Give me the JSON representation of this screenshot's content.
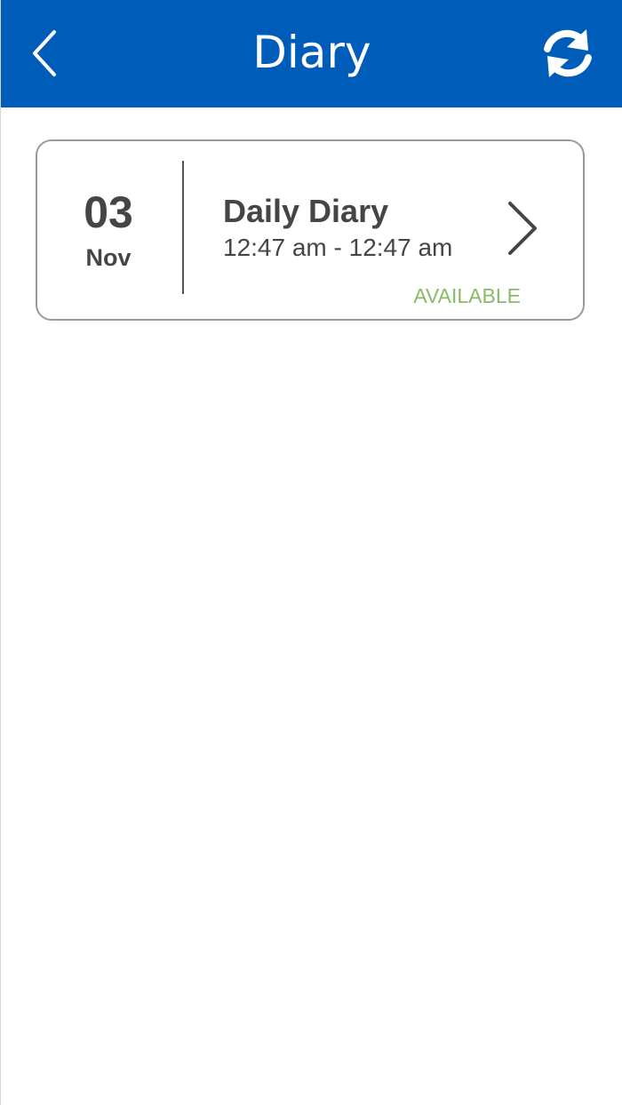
{
  "header": {
    "title": "Diary",
    "back_icon": "chevron-left-icon",
    "refresh_icon": "refresh-icon",
    "background_color": "#005cb9"
  },
  "diary_list": [
    {
      "day": "03",
      "month": "Nov",
      "title": "Daily Diary",
      "time_range": "12:47 am - 12:47 am",
      "status": "AVAILABLE",
      "status_color": "#8ab96a",
      "chevron_icon": "chevron-right-icon"
    }
  ]
}
